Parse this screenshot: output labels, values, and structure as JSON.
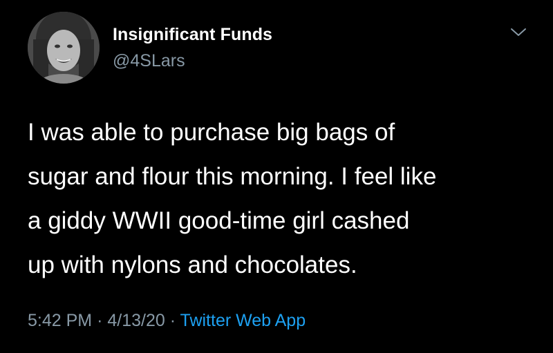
{
  "tweet": {
    "display_name": "Insignificant Funds",
    "handle": "@4SLars",
    "avatar_icon": "profile-photo",
    "menu_icon": "chevron-down-icon",
    "lines": [
      "I was able to purchase big bags of",
      "sugar and flour this morning. I feel like",
      "a giddy WWII good-time girl cashed",
      "up with nylons and chocolates."
    ],
    "time": "5:42 PM",
    "separator": "·",
    "date": "4/13/20",
    "source": "Twitter Web App"
  },
  "colors": {
    "background": "#000000",
    "text": "#ffffff",
    "secondary": "#8899a6",
    "link": "#1da1f2"
  }
}
